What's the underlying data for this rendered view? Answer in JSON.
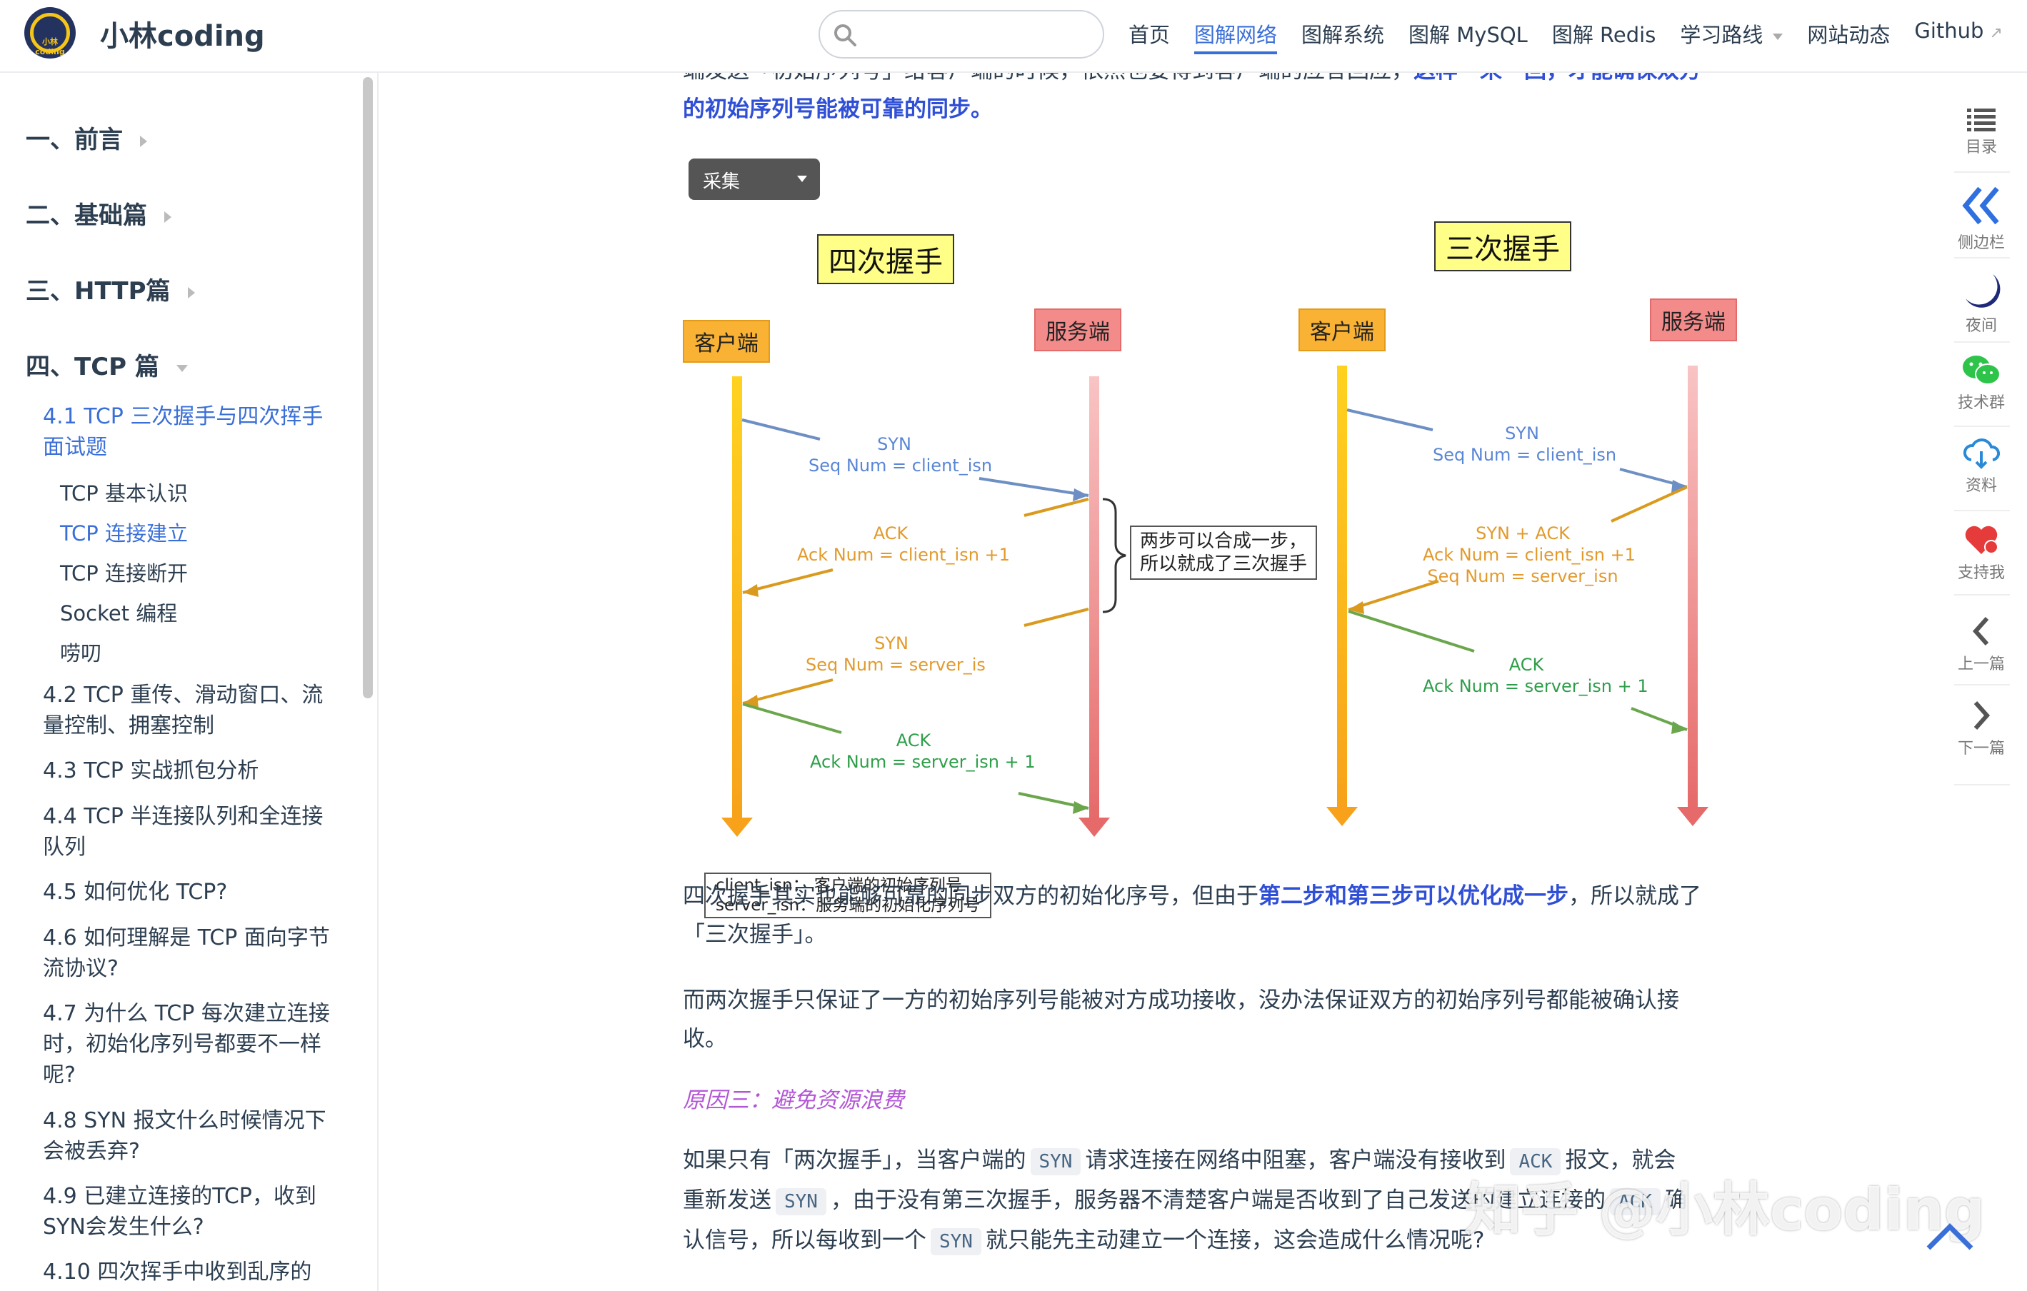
{
  "header": {
    "site_title": "小林coding",
    "logo_text": "小林coding",
    "search_placeholder": "",
    "nav": [
      {
        "label": "首页"
      },
      {
        "label": "图解网络"
      },
      {
        "label": "图解系统"
      },
      {
        "label": "图解 MySQL"
      },
      {
        "label": "图解 Redis"
      },
      {
        "label": "学习路线"
      },
      {
        "label": "网站动态"
      },
      {
        "label": "Github"
      }
    ],
    "active_nav": "图解网络"
  },
  "sidebar": {
    "sections": [
      "一、前言",
      "二、基础篇",
      "三、HTTP篇",
      "四、TCP 篇"
    ],
    "current": "4.1 TCP 三次握手与四次挥手面试题",
    "current_children": [
      "TCP 基本认识",
      "TCP 连接建立",
      "TCP 连接断开",
      "Socket 编程",
      "唠叨"
    ],
    "active_child": "TCP 连接建立",
    "items": [
      "4.2 TCP 重传、滑动窗口、流量控制、拥塞控制",
      "4.3 TCP 实战抓包分析",
      "4.4 TCP 半连接队列和全连接队列",
      "4.5 如何优化 TCP?",
      "4.6 如何理解是 TCP 面向字节流协议?",
      "4.7 为什么 TCP 每次建立连接时，初始化序列号都要不一样呢?",
      "4.8 SYN 报文什么时候情况下会被丢弃?",
      "4.9 已建立连接的TCP，收到SYN会发生什么?",
      "4.10 四次挥手中收到乱序的"
    ]
  },
  "main": {
    "top_partial": "端发送「初始序列号」给客户端的时候，依然也要得到客户端的应答回应，",
    "top_partial_bold": "这样一来一回，才能确保双方",
    "top_line2": "的初始序列号能被可靠的同步。",
    "collect_label": "采集",
    "diagram": {
      "left_title": "四次握手",
      "right_title": "三次握手",
      "client": "客户端",
      "server": "服务端",
      "four": [
        {
          "name": "SYN",
          "detail": "Seq Num = client_isn"
        },
        {
          "name": "ACK",
          "detail": "Ack Num =  client_isn +1"
        },
        {
          "name": "SYN",
          "detail": "Seq Num = server_is"
        },
        {
          "name": "ACK",
          "detail": "Ack Num = server_isn + 1"
        }
      ],
      "merge_note_1": "两步可以合成一步，",
      "merge_note_2": "所以就成了三次握手",
      "three": [
        {
          "name": "SYN",
          "detail": "Seq Num = client_isn"
        },
        {
          "name": "SYN + ACK",
          "detail": "Ack Num =  client_isn +1",
          "detail2": "Seq Num = server_isn"
        },
        {
          "name": "ACK",
          "detail": "Ack Num = server_isn + 1"
        }
      ],
      "legend_1": "client_isn：  客户端的初始序列号",
      "legend_2": "server_isn：服务端的初始化序列号"
    },
    "para1_a": "四次握手其实也能够可靠的同步双方的初始化序号，但由于",
    "para1_b": "第二步和第三步可以优化成一步",
    "para1_c": "，所以就成了",
    "para1_d": "「三次握手」。",
    "para2_a": "而两次握手只保证了一方的初始序列号能被对方成功接收，没办法保证双方的初始序列号都能被确认接",
    "para2_b": "收。",
    "reason3": "原因三：避免资源浪费",
    "para3": {
      "t1": "如果只有「两次握手」，当客户端的",
      "c1": "SYN",
      "t2": "请求连接在网络中阻塞，客户端没有接收到",
      "c2": "ACK",
      "t3": "报文，就会",
      "t4": "重新发送",
      "c3": "SYN",
      "t5": "，由于没有第三次握手，服务器不清楚客户端是否收到了自己发送的建立连接的",
      "c4": "ACK",
      "t6": "确",
      "t7": "认信号，所以每收到一个",
      "c5": "SYN",
      "t8": "就只能先主动建立一个连接，这会造成什么情况呢?"
    }
  },
  "right_toolbar": [
    "目录",
    "侧边栏",
    "夜间",
    "技术群",
    "资料",
    "支持我",
    "上一篇",
    "下一篇"
  ],
  "watermark": "知乎 @小林coding",
  "colors": {
    "accent": "#3a6fd8",
    "bold_blue": "#2f4fd6",
    "reason": "#b356d6"
  }
}
